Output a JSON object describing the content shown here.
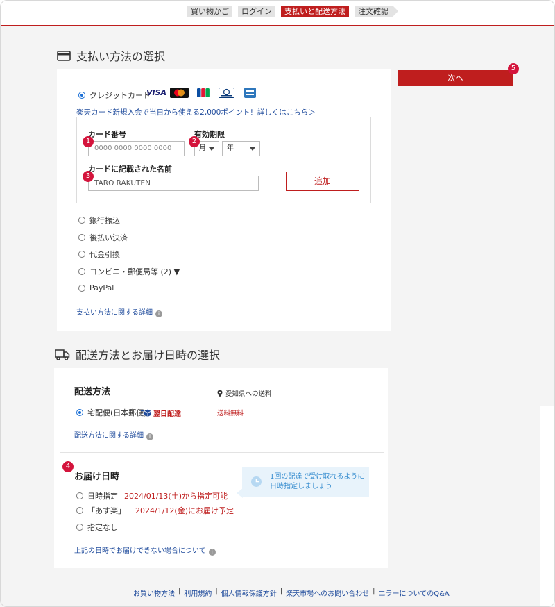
{
  "steps": [
    {
      "label": "買い物かご"
    },
    {
      "label": "ログイン"
    },
    {
      "label": "支払いと配送方法"
    },
    {
      "label": "注文確認"
    }
  ],
  "payment": {
    "title": "支払い方法の選択",
    "credit_card_label": "クレジットカード",
    "card_brands": [
      "VISA",
      "Mastercard",
      "JCB",
      "Diners Club",
      "American Express"
    ],
    "promo_link": "楽天カード新規入会で当日から使える2,000ポイント！詳しくはこちら＞",
    "card_number_label": "カード番号",
    "card_number_placeholder": "0000 0000 0000 0000",
    "expiry_label": "有効期限",
    "month_select": "月",
    "year_select": "年",
    "name_label": "カードに記載された名前",
    "name_value": "TARO RAKUTEN",
    "add_button": "追加",
    "options": [
      "銀行振込",
      "後払い決済",
      "代金引換",
      "コンビニ・郵便局等 (2) ▼",
      "PayPal"
    ],
    "details_link": "支払い方法に関する詳細"
  },
  "next_button": "次へ",
  "badges": [
    "1",
    "2",
    "3",
    "4",
    "5"
  ],
  "shipping": {
    "title": "配送方法とお届け日時の選択",
    "method_heading": "配送方法",
    "destination_note": "愛知県への送料",
    "option_label": "宅配便(日本郵便)",
    "next_day_badge": "翌日配達",
    "fee": "送料無料",
    "details_link": "配送方法に関する詳細",
    "datetime_heading": "お届け日時",
    "tip": [
      "1回の配達で受け取れるように",
      "日時指定しましょう"
    ],
    "date_options": [
      {
        "label": "日時指定",
        "note": "2024/01/13(土)から指定可能"
      },
      {
        "label": "「あす楽」",
        "note": "2024/1/12(金)にお届け予定"
      },
      {
        "label": "指定なし",
        "note": ""
      }
    ],
    "unavailable_link": "上記の日時でお届けできない場合について"
  },
  "footer_links": [
    "お買い物方法",
    "利用規約",
    "個人情報保護方針",
    "楽天市場へのお問い合わせ",
    "エラーについてのQ&A"
  ],
  "colors": {
    "accent": "#bf1e1e",
    "badge": "#d4143c",
    "link": "#1f4b9c"
  }
}
